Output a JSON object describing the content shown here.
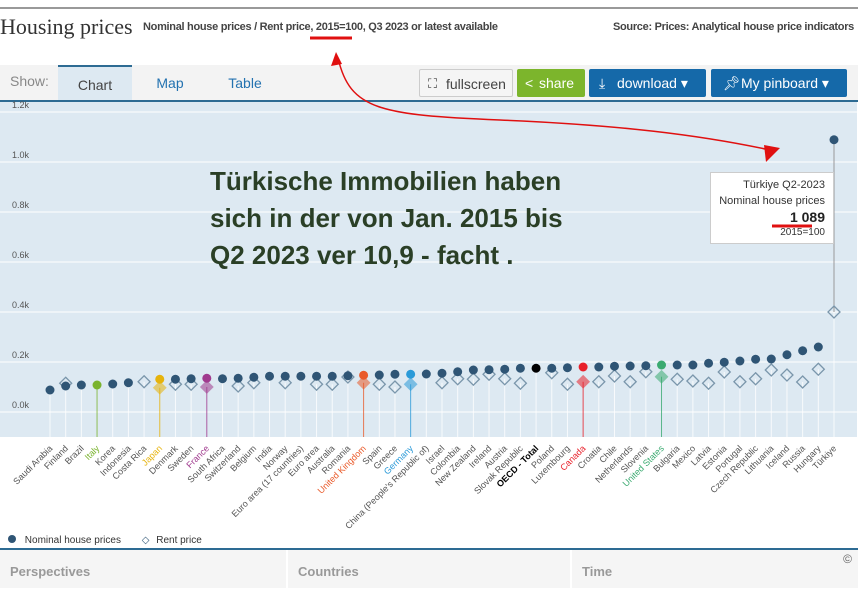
{
  "header": {
    "title": "Housing prices",
    "subtitle": "Nominal house prices / Rent price, 2015=100, Q3 2023 or latest available",
    "source": "Source: Prices: Analytical house price indicators"
  },
  "toolbar": {
    "show": "Show:",
    "tabs": [
      "Chart",
      "Map",
      "Table"
    ],
    "fullscreen": "fullscreen",
    "share": "share",
    "download": "download ▾",
    "pinboard": "My pinboard ▾"
  },
  "annotation": {
    "lines": [
      "Türkische Immobilien haben",
      "sich in der von Jan. 2015 bis",
      "Q2 2023 ver 10,9 - facht ."
    ]
  },
  "tooltip": {
    "title": "Türkiye Q2-2023",
    "series": "Nominal house prices",
    "value": "1 089",
    "unit": "2015=100"
  },
  "legend": {
    "nominal": "Nominal house prices",
    "rent": "Rent price"
  },
  "filters": {
    "perspectives": "Perspectives",
    "countries": "Countries",
    "time": "Time",
    "copyright": "©"
  },
  "colors": {
    "default": "#2f5575",
    "Italy": "#7ab32e",
    "Japan": "#e6b30c",
    "France": "#a03a8e",
    "United Kingdom": "#e95a2a",
    "Germany": "#2a9ad8",
    "OECD - Total": "#000000",
    "Canada": "#e8202a",
    "United States": "#3aaa70"
  },
  "chart_data": {
    "type": "scatter",
    "title": "Housing prices",
    "ylabel": "2015=100",
    "ylim": [
      0,
      1200
    ],
    "yticks": [
      "0.0k",
      "0.2k",
      "0.4k",
      "0.6k",
      "0.8k",
      "1.0k",
      "1.2k"
    ],
    "categories": [
      "Saudi Arabia",
      "Finland",
      "Brazil",
      "Italy",
      "Korea",
      "Indonesia",
      "Costa Rica",
      "Japan",
      "Denmark",
      "Sweden",
      "France",
      "South Africa",
      "Switzerland",
      "Belgium",
      "India",
      "Norway",
      "Euro area (17 countries)",
      "Euro area",
      "Australia",
      "Romania",
      "United Kingdom",
      "Spain",
      "Greece",
      "Germany",
      "China (People's Republic of)",
      "Israel",
      "Colombia",
      "New Zealand",
      "Ireland",
      "Austria",
      "Slovak Republic",
      "OECD - Total",
      "Poland",
      "Luxembourg",
      "Canada",
      "Croatia",
      "Chile",
      "Netherlands",
      "Slovenia",
      "United States",
      "Bulgaria",
      "Mexico",
      "Latvia",
      "Estonia",
      "Portugal",
      "Czech Republic",
      "Lithuania",
      "Iceland",
      "Russia",
      "Hungary",
      "Türkiye"
    ],
    "series": [
      {
        "name": "Nominal house prices",
        "values": [
          88,
          104,
          108,
          108,
          112,
          117,
          null,
          131,
          131,
          133,
          135,
          133,
          135,
          139,
          143,
          143,
          143,
          143,
          143,
          145,
          147,
          148,
          151,
          151,
          152,
          155,
          161,
          168,
          169,
          171,
          175,
          175,
          175,
          177,
          180,
          180,
          183,
          184,
          185,
          188,
          188,
          188,
          195,
          199,
          204,
          211,
          212,
          229,
          245,
          260,
          1089
        ]
      },
      {
        "name": "Rent price",
        "values": [
          null,
          115,
          null,
          null,
          null,
          null,
          121,
          97,
          111,
          111,
          100,
          null,
          104,
          117,
          null,
          117,
          null,
          111,
          111,
          140,
          117,
          111,
          100,
          111,
          null,
          117,
          133,
          131,
          151,
          133,
          115,
          null,
          157,
          111,
          121,
          121,
          144,
          121,
          161,
          141,
          131,
          124,
          115,
          160,
          121,
          133,
          168,
          148,
          120,
          171,
          400
        ]
      }
    ]
  }
}
